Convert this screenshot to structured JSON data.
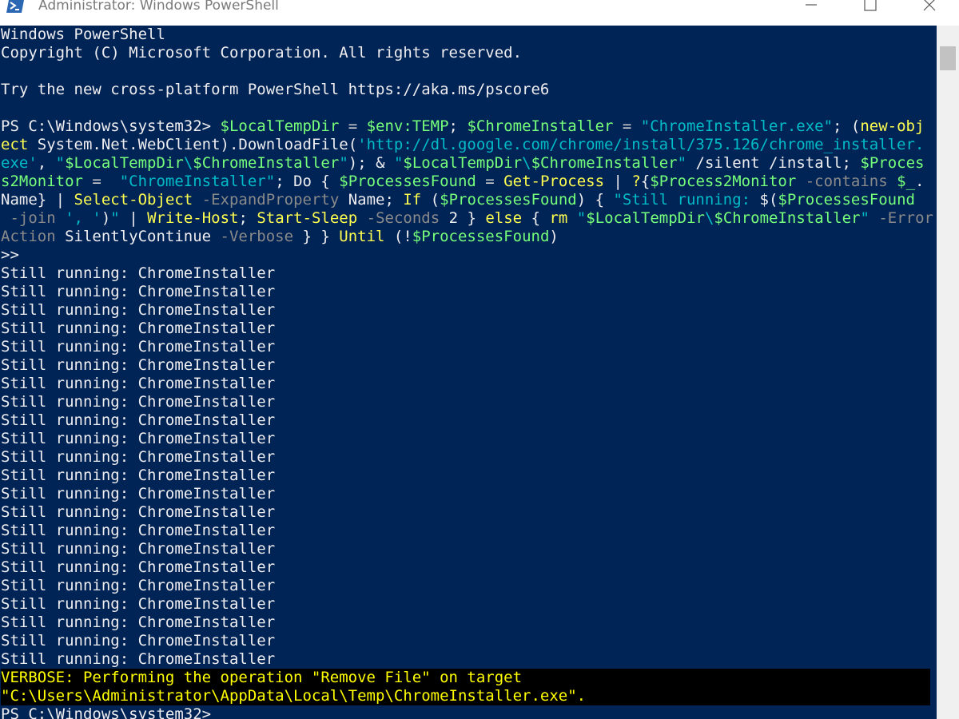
{
  "window": {
    "title": "Administrator: Windows PowerShell",
    "icon": "powershell-icon",
    "controls": [
      "minimize-icon",
      "maximize-icon",
      "close-icon"
    ]
  },
  "colors": {
    "console_bg": "#012456",
    "text": "#eeedf0",
    "variable": "#76ff7a",
    "string": "#00bcc8",
    "command": "#ffff50",
    "parameter": "#8a8a8a",
    "verbose_bg": "#000000",
    "verbose_fg": "#ffff00"
  },
  "console": {
    "banner": [
      "Windows PowerShell",
      "Copyright (C) Microsoft Corporation. All rights reserved.",
      "",
      "Try the new cross-platform PowerShell https://aka.ms/pscore6",
      ""
    ],
    "command_lines": [
      [
        {
          "t": "PS C:\\Windows\\system32> ",
          "c": "plain"
        },
        {
          "t": "$LocalTempDir",
          "c": "var"
        },
        {
          "t": " = ",
          "c": "op"
        },
        {
          "t": "$env:TEMP",
          "c": "var"
        },
        {
          "t": "; ",
          "c": "plain"
        },
        {
          "t": "$ChromeInstaller",
          "c": "var"
        },
        {
          "t": " = ",
          "c": "op"
        },
        {
          "t": "\"ChromeInstaller.exe\"",
          "c": "str"
        },
        {
          "t": "; (",
          "c": "plain"
        },
        {
          "t": "new-obj",
          "c": "cmd"
        }
      ],
      [
        {
          "t": "ect",
          "c": "cmd"
        },
        {
          "t": " System.Net.WebClient).DownloadFile(",
          "c": "plain"
        },
        {
          "t": "'http://dl.google.com/chrome/install/375.126/chrome_installer.",
          "c": "str"
        }
      ],
      [
        {
          "t": "exe'",
          "c": "str"
        },
        {
          "t": ", ",
          "c": "plain"
        },
        {
          "t": "\"",
          "c": "str"
        },
        {
          "t": "$LocalTempDir",
          "c": "var"
        },
        {
          "t": "\\",
          "c": "str"
        },
        {
          "t": "$ChromeInstaller",
          "c": "var"
        },
        {
          "t": "\"",
          "c": "str"
        },
        {
          "t": "); & ",
          "c": "plain"
        },
        {
          "t": "\"",
          "c": "str"
        },
        {
          "t": "$LocalTempDir",
          "c": "var"
        },
        {
          "t": "\\",
          "c": "str"
        },
        {
          "t": "$ChromeInstaller",
          "c": "var"
        },
        {
          "t": "\"",
          "c": "str"
        },
        {
          "t": " /silent /install; ",
          "c": "plain"
        },
        {
          "t": "$Proces",
          "c": "var"
        }
      ],
      [
        {
          "t": "s2Monitor",
          "c": "var"
        },
        {
          "t": " = ",
          "c": "op"
        },
        {
          "t": " \"ChromeInstaller\"",
          "c": "str"
        },
        {
          "t": "; Do { ",
          "c": "plain"
        },
        {
          "t": "$ProcessesFound",
          "c": "var"
        },
        {
          "t": " = ",
          "c": "op"
        },
        {
          "t": "Get-Process",
          "c": "cmd"
        },
        {
          "t": " | ",
          "c": "plain"
        },
        {
          "t": "?",
          "c": "cmd"
        },
        {
          "t": "{",
          "c": "plain"
        },
        {
          "t": "$Process2Monitor",
          "c": "var"
        },
        {
          "t": " -contains ",
          "c": "par"
        },
        {
          "t": "$_",
          "c": "var"
        },
        {
          "t": ".",
          "c": "plain"
        }
      ],
      [
        {
          "t": "Name} | ",
          "c": "plain"
        },
        {
          "t": "Select-Object",
          "c": "cmd"
        },
        {
          "t": " -ExpandProperty",
          "c": "par"
        },
        {
          "t": " Name; ",
          "c": "plain"
        },
        {
          "t": "If",
          "c": "cmd"
        },
        {
          "t": " (",
          "c": "plain"
        },
        {
          "t": "$ProcessesFound",
          "c": "var"
        },
        {
          "t": ") { ",
          "c": "plain"
        },
        {
          "t": "\"Still running: ",
          "c": "str"
        },
        {
          "t": "$(",
          "c": "plain"
        },
        {
          "t": "$ProcessesFound",
          "c": "var"
        }
      ],
      [
        {
          "t": " -join",
          "c": "par"
        },
        {
          "t": " ', '",
          "c": "str"
        },
        {
          "t": ")",
          "c": "plain"
        },
        {
          "t": "\"",
          "c": "str"
        },
        {
          "t": " | ",
          "c": "plain"
        },
        {
          "t": "Write-Host",
          "c": "cmd"
        },
        {
          "t": "; ",
          "c": "plain"
        },
        {
          "t": "Start-Sleep",
          "c": "cmd"
        },
        {
          "t": " -Seconds",
          "c": "par"
        },
        {
          "t": " 2 } ",
          "c": "plain"
        },
        {
          "t": "else",
          "c": "cmd"
        },
        {
          "t": " { ",
          "c": "plain"
        },
        {
          "t": "rm",
          "c": "cmd"
        },
        {
          "t": " ",
          "c": "plain"
        },
        {
          "t": "\"",
          "c": "str"
        },
        {
          "t": "$LocalTempDir",
          "c": "var"
        },
        {
          "t": "\\",
          "c": "str"
        },
        {
          "t": "$ChromeInstaller",
          "c": "var"
        },
        {
          "t": "\"",
          "c": "str"
        },
        {
          "t": " -Error",
          "c": "par"
        }
      ],
      [
        {
          "t": "Action",
          "c": "par"
        },
        {
          "t": " SilentlyContinue ",
          "c": "plain"
        },
        {
          "t": "-Verbose",
          "c": "par"
        },
        {
          "t": " } } ",
          "c": "plain"
        },
        {
          "t": "Until",
          "c": "cmd"
        },
        {
          "t": " (!",
          "c": "plain"
        },
        {
          "t": "$ProcessesFound",
          "c": "var"
        },
        {
          "t": ")",
          "c": "plain"
        }
      ]
    ],
    "continuation_prompt": ">>",
    "output_lines": [
      "Still running: ChromeInstaller",
      "Still running: ChromeInstaller",
      "Still running: ChromeInstaller",
      "Still running: ChromeInstaller",
      "Still running: ChromeInstaller",
      "Still running: ChromeInstaller",
      "Still running: ChromeInstaller",
      "Still running: ChromeInstaller",
      "Still running: ChromeInstaller",
      "Still running: ChromeInstaller",
      "Still running: ChromeInstaller",
      "Still running: ChromeInstaller",
      "Still running: ChromeInstaller",
      "Still running: ChromeInstaller",
      "Still running: ChromeInstaller",
      "Still running: ChromeInstaller",
      "Still running: ChromeInstaller",
      "Still running: ChromeInstaller",
      "Still running: ChromeInstaller",
      "Still running: ChromeInstaller",
      "Still running: ChromeInstaller",
      "Still running: ChromeInstaller"
    ],
    "verbose_lines": [
      "VERBOSE: Performing the operation \"Remove File\" on target",
      "\"C:\\Users\\Administrator\\AppData\\Local\\Temp\\ChromeInstaller.exe\"."
    ],
    "final_prompt": "PS C:\\Windows\\system32>"
  }
}
